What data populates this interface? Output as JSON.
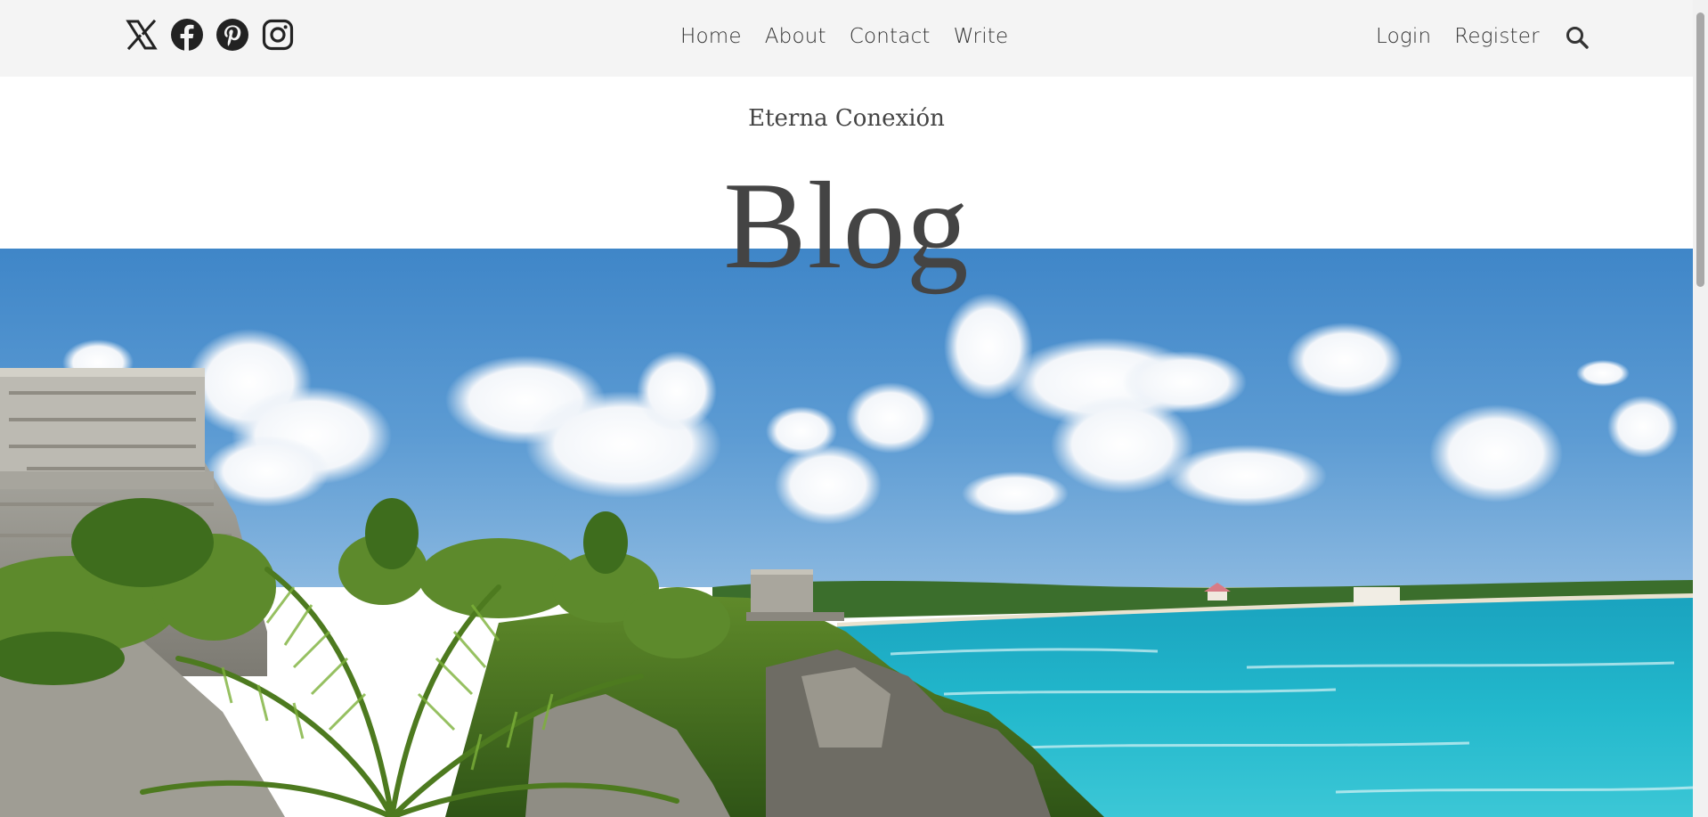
{
  "social": {
    "icons": [
      "x-icon",
      "facebook-icon",
      "pinterest-icon",
      "instagram-icon"
    ]
  },
  "nav": {
    "center": [
      "Home",
      "About",
      "Contact",
      "Write"
    ],
    "right": [
      "Login",
      "Register"
    ]
  },
  "header": {
    "subtitle": "Eterna Conexión",
    "title": "Blog"
  },
  "colors": {
    "topbar": "#f4f4f4",
    "text": "#444444",
    "sky": "#4d8fcc",
    "sea": "#23b5c9"
  }
}
